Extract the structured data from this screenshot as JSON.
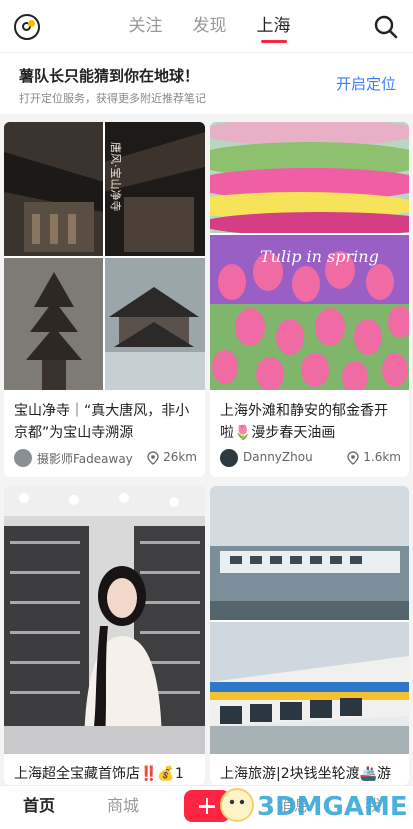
{
  "header": {
    "tabs": [
      {
        "label": "关注",
        "active": false
      },
      {
        "label": "发现",
        "active": false
      },
      {
        "label": "上海",
        "active": true
      }
    ]
  },
  "banner": {
    "title": "薯队长只能猜到你在地球！",
    "subtitle": "打开定位服务，获得更多附近推荐笔记",
    "action": "开启定位"
  },
  "feed": [
    {
      "title": "宝山净寺｜“真大唐风，非小京都”为宝山寺溯源",
      "author": "摄影师Fadeaway",
      "distance": "26km",
      "image_text": "唐风·宝山净寺"
    },
    {
      "title": "上海外滩和静安的郁金香开啦🌷漫步春天油画",
      "author": "DannyZhou",
      "distance": "1.6km",
      "image_text": "Tulip in spring"
    },
    {
      "title": "上海超全宝藏首饰店‼️💰1",
      "author": "",
      "distance": ""
    },
    {
      "title": "上海旅游|2块钱坐轮渡🚢游",
      "author": "",
      "distance": ""
    }
  ],
  "bottom_nav": {
    "home": "首页",
    "shop": "商城",
    "messages": "消息",
    "me": "我"
  },
  "watermark": "3DMGAME",
  "colors": {
    "accent": "#ff2442",
    "link": "#3b7ef6"
  }
}
